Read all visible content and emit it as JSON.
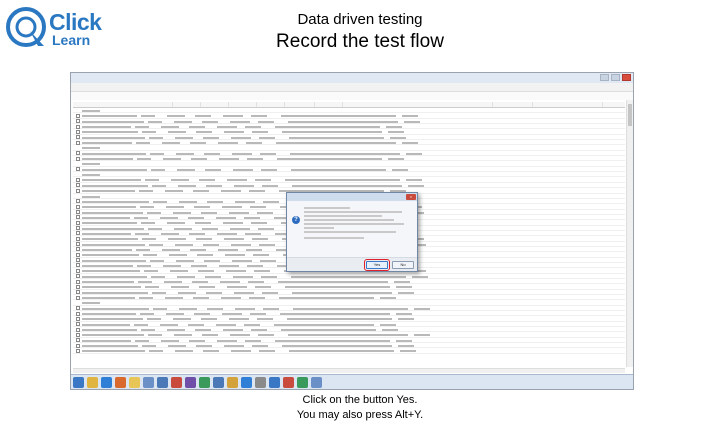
{
  "brand": {
    "line1": "Click",
    "line2": "Learn"
  },
  "slide": {
    "title_line1": "Data driven testing",
    "title_line2": "Record the test flow"
  },
  "caption": {
    "line1": "Click on the button Yes.",
    "line2": "You may also press Alt+Y."
  },
  "dialog": {
    "yes_label": "Yes",
    "no_label": "No"
  },
  "colors": {
    "brand_blue": "#2b78c2",
    "highlight_red": "#e0202a"
  },
  "grid": {
    "group_rows": [
      0,
      7,
      10,
      12,
      16,
      36
    ]
  },
  "taskbar_icons": [
    {
      "name": "start-icon",
      "color": "#3a77c4"
    },
    {
      "name": "explorer-icon",
      "color": "#e0b440"
    },
    {
      "name": "browser-icon",
      "color": "#2f7fd6"
    },
    {
      "name": "media-icon",
      "color": "#d9692c"
    },
    {
      "name": "folder-icon",
      "color": "#e7c556"
    },
    {
      "name": "app-icon",
      "color": "#6b8fc7"
    },
    {
      "name": "app-icon",
      "color": "#4b79b8"
    },
    {
      "name": "app-icon",
      "color": "#c84b3d"
    },
    {
      "name": "app-icon",
      "color": "#6f4fa8"
    },
    {
      "name": "app-icon",
      "color": "#3a9a5b"
    },
    {
      "name": "app-icon",
      "color": "#4b79b8"
    },
    {
      "name": "app-icon",
      "color": "#d4a23a"
    },
    {
      "name": "app-icon",
      "color": "#2f7fd6"
    },
    {
      "name": "app-icon",
      "color": "#8a8a8a"
    },
    {
      "name": "app-icon",
      "color": "#3a77c4"
    },
    {
      "name": "app-icon",
      "color": "#c84b3d"
    },
    {
      "name": "app-icon",
      "color": "#3a9a5b"
    },
    {
      "name": "app-icon",
      "color": "#6b8fc7"
    }
  ]
}
